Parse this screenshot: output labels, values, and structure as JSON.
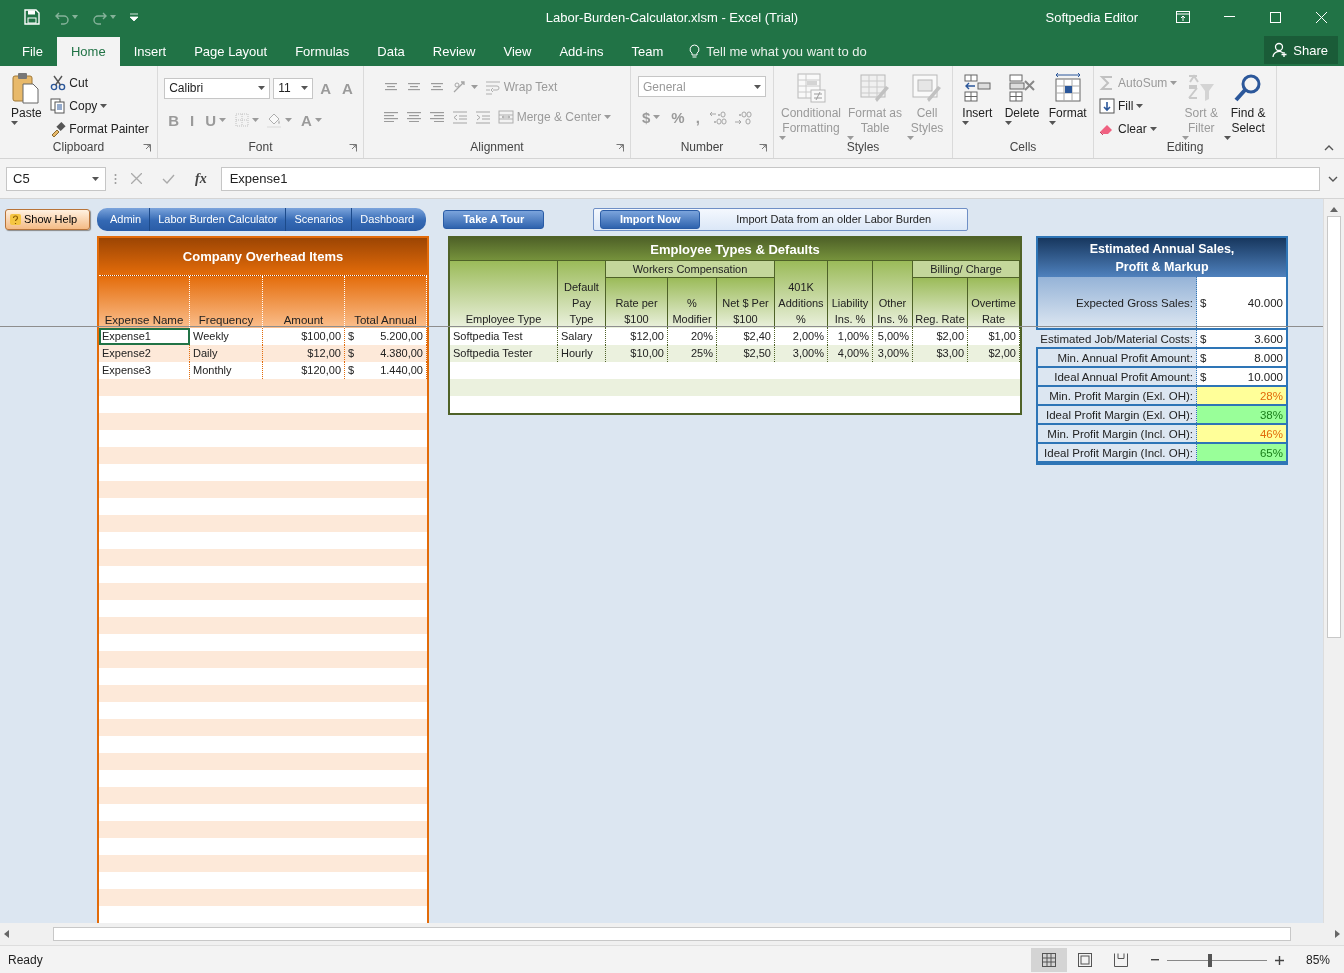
{
  "window": {
    "title": "Labor-Burden-Calculator.xlsm - Excel (Trial)",
    "user": "Softpedia Editor"
  },
  "quick_access": [
    {
      "disabled": false
    },
    {
      "disabled": true
    },
    {
      "disabled": true
    }
  ],
  "ribbon_tabs": [
    {
      "label": "File",
      "selected": false
    },
    {
      "label": "Home",
      "selected": true
    },
    {
      "label": "Insert",
      "selected": false
    },
    {
      "label": "Page Layout",
      "selected": false
    },
    {
      "label": "Formulas",
      "selected": false
    },
    {
      "label": "Data",
      "selected": false
    },
    {
      "label": "Review",
      "selected": false
    },
    {
      "label": "View",
      "selected": false
    },
    {
      "label": "Add-ins",
      "selected": false
    },
    {
      "label": "Team",
      "selected": false
    }
  ],
  "tell_me": "Tell me what you want to do",
  "share": "Share",
  "ribbon_groups": [
    {
      "label": "Clipboard",
      "launcher": true,
      "items": [
        {
          "kind": "large",
          "label": "Paste",
          "dropdown": true,
          "disabled": false
        },
        {
          "kind": "small",
          "label": "Cut",
          "dropdown": false,
          "disabled": false
        },
        {
          "kind": "small",
          "label": "Copy",
          "dropdown": true,
          "disabled": false
        },
        {
          "kind": "small",
          "label": "Format Painter",
          "dropdown": false,
          "disabled": false
        }
      ]
    },
    {
      "label": "Font",
      "launcher": true,
      "upper": [
        {
          "kind": "field",
          "value": "Calibri",
          "dropdown": true,
          "disabled": false
        },
        {
          "kind": "field",
          "value": "11",
          "dropdown": true,
          "disabled": false
        },
        {
          "kind": "glyph",
          "text": "A",
          "dropdown": false,
          "disabled": true
        },
        {
          "kind": "glyph",
          "text": "A",
          "dropdown": false,
          "disabled": true
        }
      ],
      "lower": [
        {
          "kind": "glyph",
          "text": "B",
          "dropdown": false,
          "disabled": true
        },
        {
          "kind": "glyph",
          "text": "I",
          "dropdown": false,
          "disabled": true
        },
        {
          "kind": "glyph",
          "text": "U",
          "dropdown": true,
          "disabled": true
        },
        {
          "kind": "icon",
          "dropdown": true,
          "disabled": true
        },
        {
          "kind": "icon",
          "dropdown": true,
          "disabled": true
        },
        {
          "kind": "glyph",
          "text": "A",
          "dropdown": true,
          "disabled": true
        }
      ]
    },
    {
      "label": "Alignment",
      "launcher": true,
      "upper": [
        {
          "kind": "icon",
          "dropdown": false,
          "disabled": true
        },
        {
          "kind": "icon",
          "dropdown": false,
          "disabled": true
        },
        {
          "kind": "icon",
          "dropdown": false,
          "disabled": true
        },
        {
          "kind": "icon",
          "dropdown": true,
          "disabled": true
        },
        {
          "kind": "small",
          "label": "Wrap Text",
          "dropdown": false,
          "disabled": true
        }
      ],
      "lower": [
        {
          "kind": "icon",
          "dropdown": false,
          "disabled": true
        },
        {
          "kind": "icon",
          "dropdown": false,
          "disabled": true
        },
        {
          "kind": "icon",
          "dropdown": false,
          "disabled": true
        },
        {
          "kind": "icon",
          "dropdown": false,
          "disabled": true
        },
        {
          "kind": "icon",
          "dropdown": false,
          "disabled": true
        },
        {
          "kind": "small",
          "label": "Merge & Center",
          "dropdown": true,
          "disabled": true
        }
      ]
    },
    {
      "label": "Number",
      "launcher": true,
      "upper": [
        {
          "kind": "field",
          "value": "General",
          "dropdown": true,
          "disabled": true
        }
      ],
      "lower": [
        {
          "kind": "glyph",
          "text": "$",
          "dropdown": true,
          "disabled": true
        },
        {
          "kind": "glyph",
          "text": "%",
          "dropdown": false,
          "disabled": true
        },
        {
          "kind": "glyph",
          "text": ",",
          "dropdown": false,
          "disabled": true
        },
        {
          "kind": "icon",
          "dropdown": false,
          "disabled": true
        },
        {
          "kind": "icon",
          "dropdown": false,
          "disabled": true
        }
      ]
    },
    {
      "label": "Styles",
      "launcher": false,
      "items": [
        {
          "kind": "large",
          "label": "Conditional Formatting",
          "dropdown": true,
          "disabled": true
        },
        {
          "kind": "large",
          "label": "Format as Table",
          "dropdown": true,
          "disabled": true
        },
        {
          "kind": "large",
          "label": "Cell Styles",
          "dropdown": true,
          "disabled": true
        }
      ]
    },
    {
      "label": "Cells",
      "launcher": false,
      "items": [
        {
          "kind": "large",
          "label": "Insert",
          "dropdown": true,
          "disabled": false
        },
        {
          "kind": "large",
          "label": "Delete",
          "dropdown": true,
          "disabled": false
        },
        {
          "kind": "large",
          "label": "Format",
          "dropdown": true,
          "disabled": false
        }
      ]
    },
    {
      "label": "Editing",
      "launcher": false,
      "items": [
        {
          "kind": "small",
          "label": "AutoSum",
          "dropdown": true,
          "disabled": true
        },
        {
          "kind": "small",
          "label": "Fill",
          "dropdown": true,
          "disabled": false
        },
        {
          "kind": "small",
          "label": "Clear",
          "dropdown": true,
          "disabled": false
        },
        {
          "kind": "large",
          "label": "Sort & Filter",
          "dropdown": true,
          "disabled": true
        },
        {
          "kind": "large",
          "label": "Find & Select",
          "dropdown": true,
          "disabled": false
        }
      ]
    }
  ],
  "name_box": "C5",
  "function_label": "fx",
  "formula": "Expense1",
  "sheet_buttons": {
    "help": "Show Help",
    "nav": [
      "Admin",
      "Labor Burden Calculator",
      "Scenarios",
      "Dashboard"
    ],
    "tour": "Take A Tour",
    "import_button": "Import Now",
    "import_note": "Import Data from an older Labor Burden"
  },
  "overhead": {
    "title": "Company Overhead Items",
    "columns": [
      "Expense Name",
      "Frequency",
      "Amount",
      "Total Annual"
    ],
    "rows": [
      {
        "name": "Expense1",
        "frequency": "Weekly",
        "amount": "$100,00",
        "symbol": "$",
        "total": "5.200,00",
        "selected": true
      },
      {
        "name": "Expense2",
        "frequency": "Daily",
        "amount": "$12,00",
        "symbol": "$",
        "total": "4.380,00",
        "selected": false
      },
      {
        "name": "Expense3",
        "frequency": "Monthly",
        "amount": "$120,00",
        "symbol": "$",
        "total": "1.440,00",
        "selected": false
      }
    ]
  },
  "employees": {
    "title": "Employee Types & Defaults",
    "column_groups": [
      "Workers Compensation",
      "Billing/ Charge"
    ],
    "columns": [
      "Employee Type",
      "Default Pay Type",
      "Rate per $100",
      "% Modifier",
      "Net $ Per $100",
      "401K Additions %",
      "Liability Ins. %",
      "Other Ins. %",
      "Reg. Rate",
      "Overtime Rate"
    ],
    "rows": [
      [
        "Softpedia Test",
        "Salary",
        "$12,00",
        "20%",
        {
          "symbol": "$",
          "amount": "2,40"
        },
        "2,00%",
        "1,00%",
        "5,00%",
        "$2,00",
        {
          "symbol": "$",
          "amount": "1,00"
        }
      ],
      [
        "Softpedia Tester",
        "Hourly",
        "$10,00",
        "25%",
        {
          "symbol": "$",
          "amount": "2,50"
        },
        "3,00%",
        "4,00%",
        "3,00%",
        "$3,00",
        {
          "symbol": "$",
          "amount": "2,00"
        }
      ]
    ]
  },
  "estimates": {
    "title": "Estimated Annual Sales, Profit & Markup",
    "rows": [
      {
        "label": "Expected Gross Sales:",
        "symbol": "$",
        "value": "40.000",
        "kind": "input"
      },
      {
        "label": "Estimated Job/Material Costs:",
        "symbol": "$",
        "value": "3.600",
        "kind": "input"
      },
      {
        "label": "Min. Annual Profit Amount:",
        "symbol": "$",
        "value": "8.000",
        "kind": "input"
      },
      {
        "label": "Ideal Annual Profit Amount:",
        "symbol": "$",
        "value": "10.000",
        "kind": "input"
      },
      {
        "label": "Min. Profit Margin (Exl. OH):",
        "value": "28%",
        "kind": "warning"
      },
      {
        "label": "Ideal Profit Margin (Exl. OH):",
        "value": "38%",
        "kind": "good"
      },
      {
        "label": "Min. Profit Margin (Incl. OH):",
        "value": "46%",
        "kind": "warning"
      },
      {
        "label": "Ideal Profit Margin (Incl. OH):",
        "value": "65%",
        "kind": "good"
      }
    ]
  },
  "status_bar": {
    "text": "Ready",
    "views": [
      {
        "selected": true
      },
      {
        "selected": false
      },
      {
        "selected": false
      }
    ],
    "zoom": {
      "level": 0.43,
      "reading": "85%"
    }
  }
}
